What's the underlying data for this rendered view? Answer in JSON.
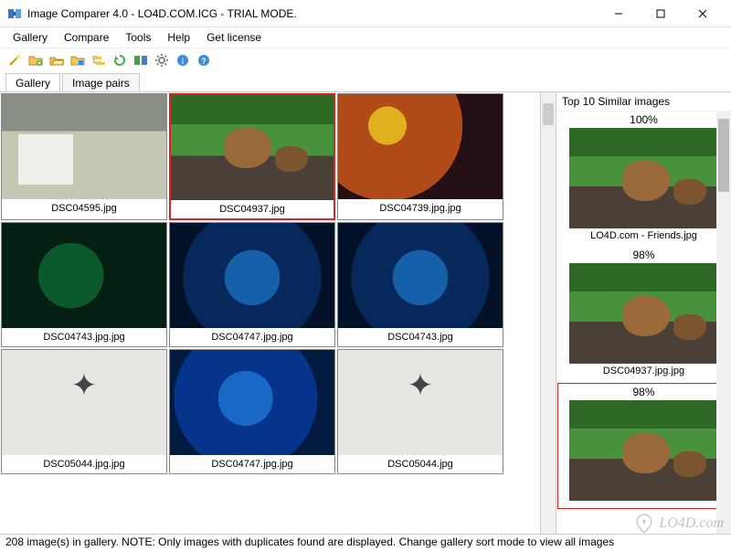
{
  "window": {
    "title": "Image Comparer 4.0 - LO4D.COM.ICG - TRIAL MODE."
  },
  "menu": {
    "items": [
      "Gallery",
      "Compare",
      "Tools",
      "Help",
      "Get license"
    ]
  },
  "toolbar": {
    "icons": [
      "wand-icon",
      "new-folder-icon",
      "open-folder-icon",
      "add-folder-icon",
      "folder-tree-icon",
      "refresh-icon",
      "compare-icon",
      "gear-icon",
      "info-icon",
      "help-icon"
    ]
  },
  "subtabs": {
    "items": [
      "Gallery",
      "Image pairs"
    ],
    "active": 0
  },
  "gallery": {
    "rows": [
      [
        {
          "file": "DSC04595.jpg",
          "style": "img-landscape",
          "selected": false
        },
        {
          "file": "DSC04937.jpg",
          "style": "img-lemur",
          "selected": true
        },
        {
          "file": "DSC04739.jpg.jpg",
          "style": "img-cave-r",
          "selected": false
        }
      ],
      [
        {
          "file": "DSC04743.jpg.jpg",
          "style": "img-cave-g",
          "selected": false
        },
        {
          "file": "DSC04747.jpg.jpg",
          "style": "img-cave-b",
          "selected": false
        },
        {
          "file": "DSC04743.jpg",
          "style": "img-cave-b",
          "selected": false
        }
      ],
      [
        {
          "file": "DSC05044.jpg.jpg",
          "style": "img-vane",
          "selected": false
        },
        {
          "file": "DSC04747.jpg.jpg",
          "style": "img-cave-b2",
          "selected": false
        },
        {
          "file": "DSC05044.jpg",
          "style": "img-vane",
          "selected": false
        }
      ]
    ]
  },
  "right": {
    "title": "Top 10 Similar images",
    "items": [
      {
        "pct": "100%",
        "file": "LO4D.com - Friends.jpg",
        "style": "img-lemur",
        "selected": false
      },
      {
        "pct": "98%",
        "file": "DSC04937.jpg.jpg",
        "style": "img-lemur",
        "selected": false
      },
      {
        "pct": "98%",
        "file": "",
        "style": "img-lemur",
        "selected": true
      }
    ]
  },
  "status": {
    "text": "208 image(s) in gallery. NOTE: Only images with duplicates found are displayed. Change gallery sort mode to view all images"
  },
  "watermark": {
    "text": "LO4D.com"
  }
}
